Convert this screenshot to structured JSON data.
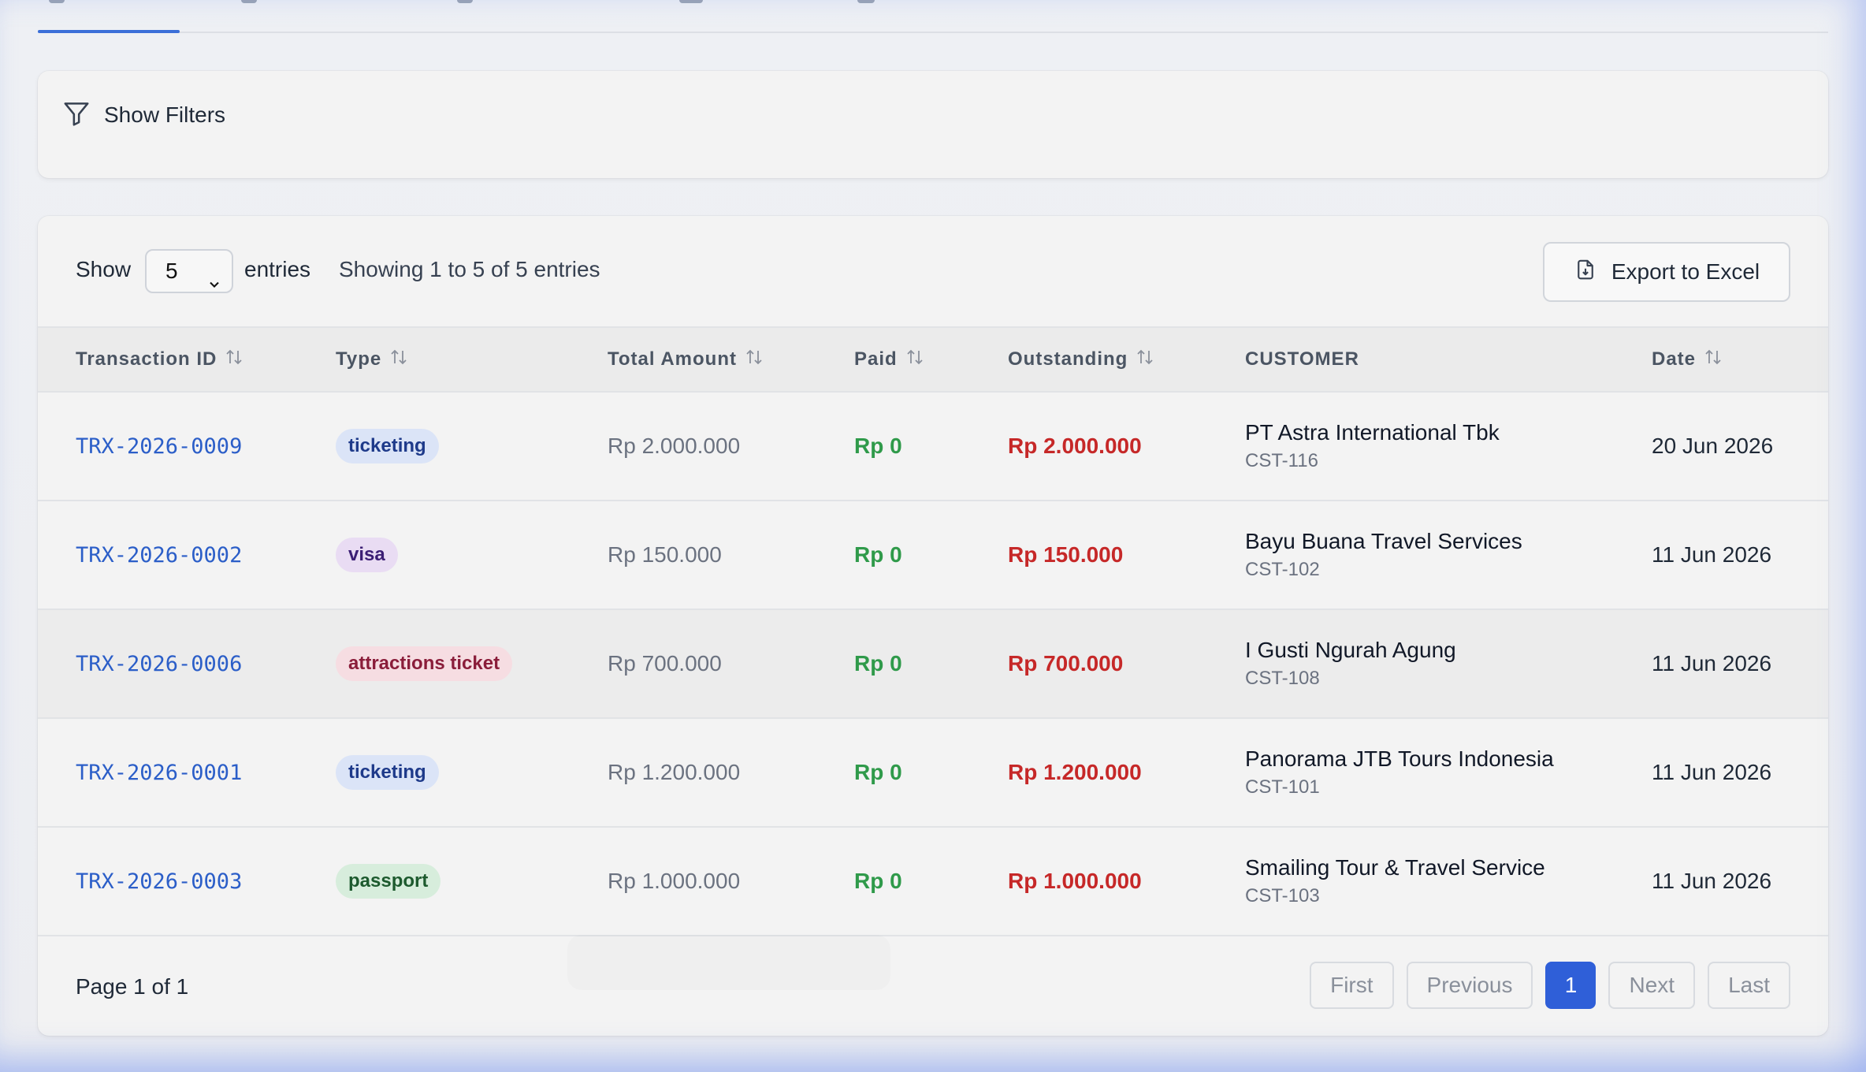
{
  "filters": {
    "label": "Show Filters"
  },
  "toolbar": {
    "show_label": "Show",
    "page_size": "5",
    "entries_label": "entries",
    "showing_text": "Showing 1 to 5 of 5 entries",
    "export_label": "Export to Excel"
  },
  "table": {
    "headers": {
      "transaction_id": "Transaction ID",
      "type": "Type",
      "total_amount": "Total Amount",
      "paid": "Paid",
      "outstanding": "Outstanding",
      "customer": "CUSTOMER",
      "date": "Date"
    },
    "rows": [
      {
        "id": "TRX-2026-0009",
        "type": "ticketing",
        "total": "Rp 2.000.000",
        "paid": "Rp 0",
        "outstanding": "Rp 2.000.000",
        "customer": "PT Astra International Tbk",
        "customer_id": "CST-116",
        "date": "20 Jun 2026"
      },
      {
        "id": "TRX-2026-0002",
        "type": "visa",
        "total": "Rp 150.000",
        "paid": "Rp 0",
        "outstanding": "Rp 150.000",
        "customer": "Bayu Buana Travel Services",
        "customer_id": "CST-102",
        "date": "11 Jun 2026"
      },
      {
        "id": "TRX-2026-0006",
        "type": "attractions ticket",
        "total": "Rp 700.000",
        "paid": "Rp 0",
        "outstanding": "Rp 700.000",
        "customer": "I Gusti Ngurah Agung",
        "customer_id": "CST-108",
        "date": "11 Jun 2026"
      },
      {
        "id": "TRX-2026-0001",
        "type": "ticketing",
        "total": "Rp 1.200.000",
        "paid": "Rp 0",
        "outstanding": "Rp 1.200.000",
        "customer": "Panorama JTB Tours Indonesia",
        "customer_id": "CST-101",
        "date": "11 Jun 2026"
      },
      {
        "id": "TRX-2026-0003",
        "type": "passport",
        "total": "Rp 1.000.000",
        "paid": "Rp 0",
        "outstanding": "Rp 1.000.000",
        "customer": "Smailing Tour & Travel Service",
        "customer_id": "CST-103",
        "date": "11 Jun 2026"
      }
    ]
  },
  "pagination": {
    "page_text": "Page 1 of 1",
    "first": "First",
    "previous": "Previous",
    "current": "1",
    "next": "Next",
    "last": "Last"
  },
  "colors": {
    "accent": "#2f5fd8",
    "link": "#2b5ec8",
    "paid": "#2f9a4a",
    "outstanding": "#c62828"
  }
}
